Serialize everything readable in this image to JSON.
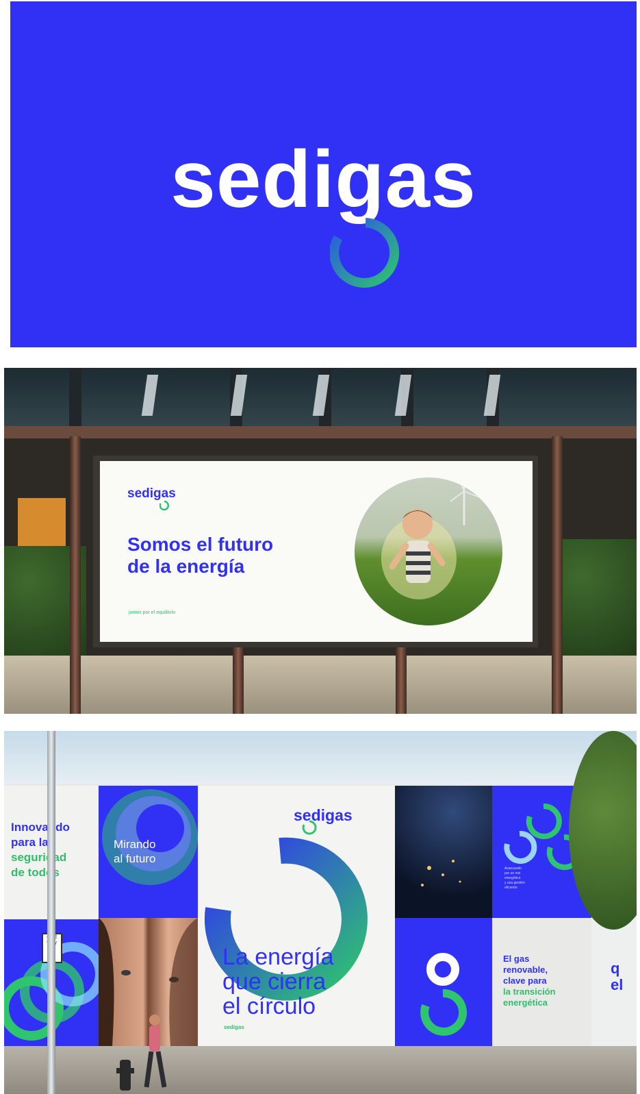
{
  "panel1": {
    "logo_text": "sedigas",
    "colors": {
      "background": "#3131f5",
      "logo": "#ffffff",
      "ring_blue": "#2c55e8",
      "ring_green": "#2fc46e"
    }
  },
  "panel2": {
    "billboard": {
      "logo_text": "sedigas",
      "headline_line1": "Somos el futuro",
      "headline_line2": "de la energía",
      "tagline": "juntos por el equilibrio"
    }
  },
  "panel3": {
    "tile1_lines": [
      "Innovando",
      "para la",
      "seguridad",
      "de todos"
    ],
    "tile2_lines": [
      "Mirando",
      "al futuro"
    ],
    "center_logo": "sedigas",
    "center_headline_lines": [
      "La energía",
      "que cierra",
      "el círculo"
    ],
    "center_footer_logo": "sedigas",
    "tile_small_text_lines": [
      "Avanzando",
      "por un mix",
      "energético",
      "y una gestión",
      "eficiente"
    ],
    "tile_green_lines": [
      "El gas",
      "renovable,",
      "clave para",
      "la transición",
      "energética"
    ],
    "edge_text_lines": [
      "q",
      "el"
    ],
    "sign_text": [
      "ONE",
      "WAY"
    ]
  }
}
